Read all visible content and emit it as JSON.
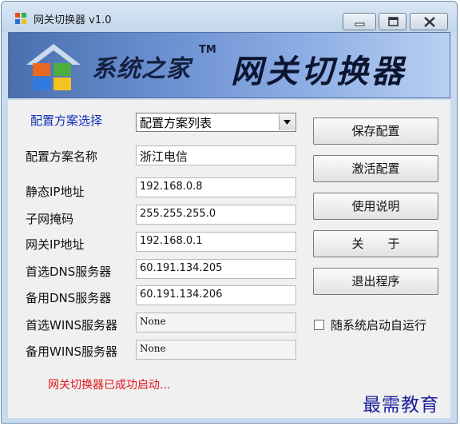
{
  "window": {
    "title": "网关切换器 v1.0",
    "controls": {
      "minimize_icon": "minimize-icon",
      "maximize_icon": "maximize-icon",
      "close_icon": "close-icon"
    }
  },
  "banner": {
    "site_name": "系统之家",
    "trademark": "TM",
    "app_name": "网关切换器",
    "logo_icon": "windows-logo-house"
  },
  "form": {
    "scheme_select": {
      "label": "配置方案选择",
      "value": "配置方案列表"
    },
    "fields": [
      {
        "label": "配置方案名称",
        "value": "浙江电信"
      },
      {
        "label": "静态IP地址",
        "value": "192.168.0.8"
      },
      {
        "label": "子网掩码",
        "value": "255.255.255.0"
      },
      {
        "label": "网关IP地址",
        "value": "192.168.0.1"
      },
      {
        "label": "首选DNS服务器",
        "value": "60.191.134.205"
      },
      {
        "label": "备用DNS服务器",
        "value": "60.191.134.206"
      },
      {
        "label": "首选WINS服务器",
        "value": "None"
      },
      {
        "label": "备用WINS服务器",
        "value": "None"
      }
    ]
  },
  "buttons": {
    "save": "保存配置",
    "activate": "激活配置",
    "help": "使用说明",
    "about": "关于",
    "exit": "退出程序"
  },
  "autostart": {
    "label": "随系统启动自运行",
    "checked": false
  },
  "status": {
    "text": "网关切换器已成功启动...",
    "color": "#e0141a"
  },
  "watermark": "最需教育"
}
